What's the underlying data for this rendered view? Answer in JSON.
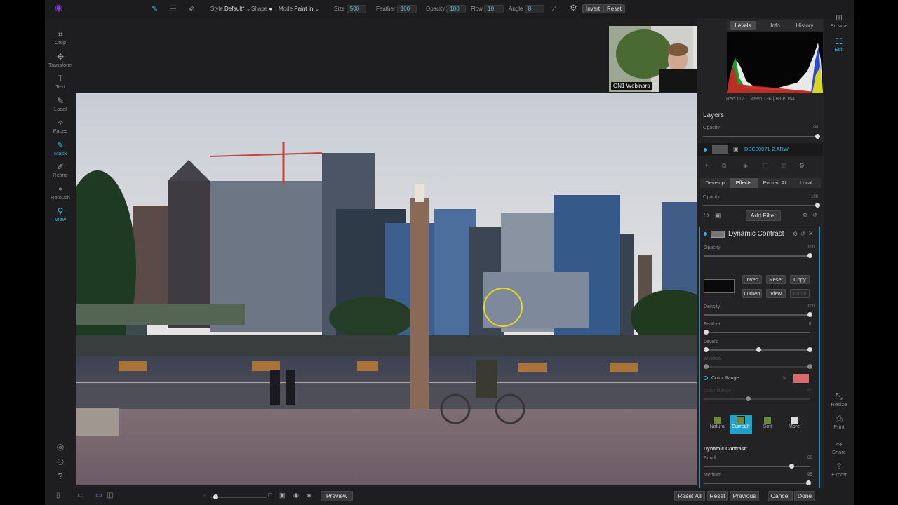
{
  "toolbar": {
    "style_label": "Style",
    "style_value": "Default*",
    "shape_label": "Shape",
    "mode_label": "Mode",
    "mode_value": "Paint In",
    "size_label": "Size",
    "size_value": "500",
    "feather_label": "Feather",
    "feather_value": "100",
    "opacity_label": "Opacity",
    "opacity_value": "100",
    "flow_label": "Flow",
    "flow_value": "10",
    "angle_label": "Angle",
    "angle_value": "8",
    "invert_label": "Invert",
    "reset_label": "Reset"
  },
  "left_tools": [
    {
      "label": "Crop",
      "icon": "crop-icon"
    },
    {
      "label": "Transform",
      "icon": "move-icon"
    },
    {
      "label": "Text",
      "icon": "text-icon"
    },
    {
      "label": "Local",
      "icon": "brush-icon"
    },
    {
      "label": "Faces",
      "icon": "faces-icon"
    },
    {
      "label": "Mask",
      "icon": "mask-brush-icon"
    },
    {
      "label": "Refine",
      "icon": "refine-icon"
    },
    {
      "label": "Retouch",
      "icon": "retouch-icon"
    },
    {
      "label": "View",
      "icon": "zoom-icon"
    }
  ],
  "right_tools": {
    "browse": "Browse",
    "edit": "Edit",
    "resize": "Resize",
    "print": "Print",
    "share": "Share",
    "export": "Export"
  },
  "webcam": {
    "caption": "ON1 Webinars"
  },
  "panel": {
    "tabs": [
      "Levels",
      "Info",
      "History"
    ],
    "rgb_readout": "Red 117 | Green 136 | Blue 164",
    "layers_title": "Layers",
    "opacity_label": "Opacity",
    "opacity_value": "100",
    "layer_name": "DSC00071-2.ARW",
    "module_tabs": [
      "Develop",
      "Effects",
      "Portrait AI",
      "Local"
    ],
    "effects_opacity_label": "Opacity",
    "effects_opacity_value": "100",
    "add_filter": "Add Filter",
    "filter_name": "Dynamic Contrast",
    "filter_opacity_label": "Opacity",
    "filter_opacity_value": "100",
    "mask_buttons": [
      "Invert",
      "Reset",
      "Copy",
      "Lumen",
      "View",
      "Paste"
    ],
    "density_label": "Density",
    "density_value": "100",
    "feather_label": "Feather",
    "feather_value": "0",
    "levels_label": "Levels",
    "window_label": "Window",
    "color_range_label": "Color Range",
    "color_range_sub_label": "Color Range",
    "color_range_sub_value": "40",
    "color_range_swatch": "#d96a6a",
    "presets": [
      "Natural",
      "Surreal*",
      "Soft",
      "More"
    ],
    "dc_section_label": "Dynamic Contrast:",
    "small_label": "Small",
    "small_value": "66",
    "medium_label": "Medium",
    "medium_value": "95"
  },
  "bottom": {
    "preview": "Preview",
    "reset_all": "Reset All",
    "reset": "Reset",
    "previous": "Previous",
    "cancel": "Cancel",
    "done": "Done"
  },
  "colors": {
    "accent": "#36b6dd",
    "cursor_ring": "#e8d818"
  }
}
